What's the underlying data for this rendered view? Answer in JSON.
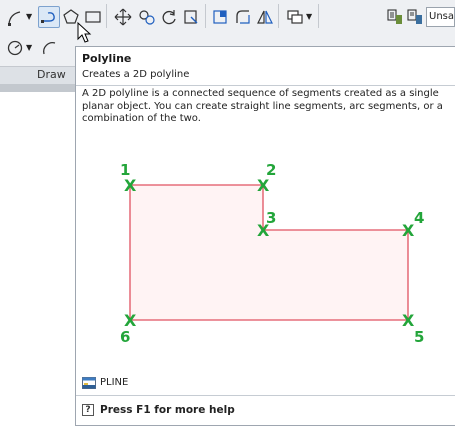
{
  "ribbon": {
    "style_combo_value": "Unsav",
    "panel_label": "Draw",
    "tools_row1": [
      "line-icon",
      "polyline-icon",
      "polygon-icon",
      "rectangle-icon",
      "move-icon",
      "copy-icon",
      "rotate-icon",
      "trim-icon",
      "region-icon",
      "fillet-icon",
      "mirror-icon",
      "layer-icon",
      "match-properties-icon",
      "layer-state-icon"
    ],
    "tools_row2": [
      "circle-icon",
      "arc-icon"
    ]
  },
  "tooltip": {
    "title": "Polyline",
    "subtitle": "Creates a 2D polyline",
    "description": "A 2D polyline is a connected sequence of segments created as a single planar object. You can create straight line segments, arc segments, or a combination of the two.",
    "command": "PLINE",
    "help_text": "Press F1 for more help",
    "help_glyph": "?",
    "diagram": {
      "points": [
        {
          "label": "1",
          "marker": "X"
        },
        {
          "label": "2",
          "marker": "X"
        },
        {
          "label": "3",
          "marker": "X"
        },
        {
          "label": "4",
          "marker": "X"
        },
        {
          "label": "5",
          "marker": "X"
        },
        {
          "label": "6",
          "marker": "X"
        }
      ],
      "line_color": "#e05260",
      "fill_color": "#fff3f4",
      "marker_color": "#23a53a"
    }
  }
}
